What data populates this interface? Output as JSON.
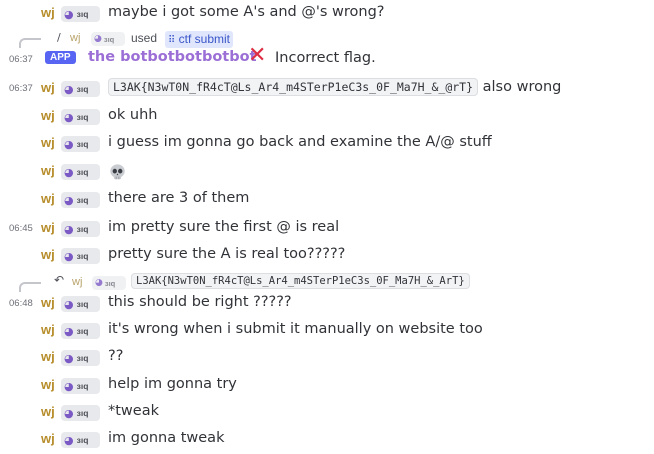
{
  "author": {
    "name": "wj",
    "tag": "ɜıq"
  },
  "colors": {
    "author": "#b68d2a",
    "bot": "#9b6fd6",
    "app_badge": "#5865f2",
    "command": "#3a56c8"
  },
  "messages": [
    {
      "text": "maybe i got some A's and @'s wrong?"
    },
    {
      "command_reply": {
        "used": "used",
        "command": "ctf submit"
      }
    },
    {
      "time": "06:37",
      "app_badge": "APP",
      "bot_name": "the botbotbotbotbot",
      "text": "Incorrect flag."
    },
    {
      "time": "06:37",
      "code": "L3AK{N3wT0N_fR4cT@Ls_Ar4_m4STerP1eC3s_0F_Ma7H_&_@rT}",
      "text": " also wrong"
    },
    {
      "text": "ok uhh"
    },
    {
      "text": "i guess im gonna go back and examine the A/@ stuff"
    },
    {
      "text": ""
    },
    {
      "text": "there are 3 of them"
    },
    {
      "time": "06:45",
      "text": "im pretty sure the first @ is real"
    },
    {
      "text": "pretty sure the A is real too?????"
    },
    {
      "reply_code": "L3AK{N3wT0N_fR4cT@Ls_Ar4_m4STerP1eC3s_0F_Ma7H_&_ArT}"
    },
    {
      "time": "06:48",
      "text": "this should be right ?????"
    },
    {
      "text": "it's wrong when i submit it manually on website too"
    },
    {
      "text": "??"
    },
    {
      "text": "help im gonna try"
    },
    {
      "text": "*tweak"
    },
    {
      "text": "im gonna tweak"
    }
  ]
}
